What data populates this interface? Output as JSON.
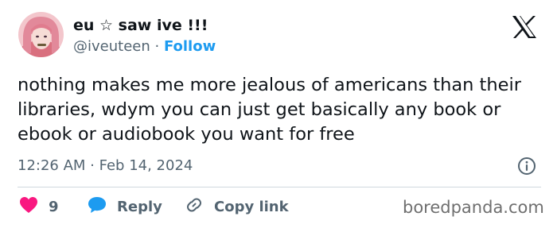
{
  "author": {
    "display_name": "eu ☆ saw ive !!!",
    "handle": "@iveuteen",
    "separator": "·",
    "follow_label": "Follow",
    "avatar_icon": "profile-photo"
  },
  "platform_icon": "x-logo-icon",
  "tweet": {
    "text": "nothing makes me more jealous of americans than their libraries, wdym you can just get basically any book or ebook or audiobook you want for free",
    "timestamp": "12:26 AM · Feb 14, 2024"
  },
  "actions": {
    "like_count": "9",
    "reply_label": "Reply",
    "copy_link_label": "Copy link"
  },
  "colors": {
    "text": "#0f1419",
    "secondary": "#536471",
    "follow": "#1d9bf0",
    "like": "#f91880",
    "reply": "#1d9bf0",
    "divider": "#cfd9de"
  },
  "watermark": "boredpanda.com"
}
